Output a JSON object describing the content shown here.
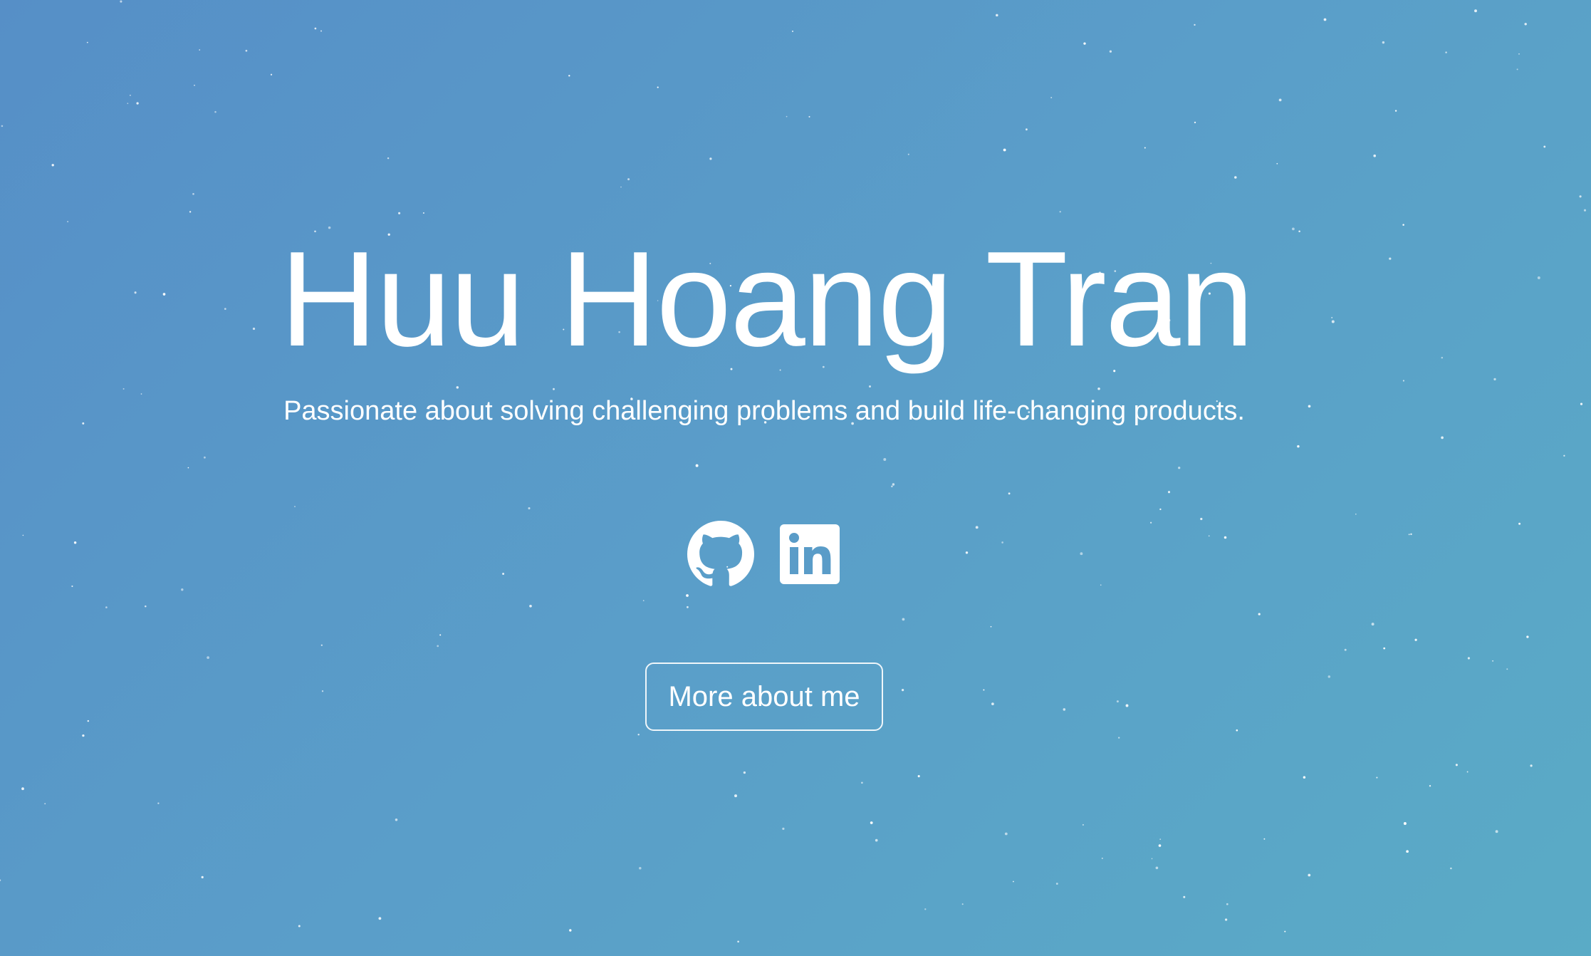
{
  "hero": {
    "title": "Huu Hoang Tran",
    "subtitle": "Passionate about solving challenging problems and build life-changing products."
  },
  "social": {
    "links": [
      {
        "icon": "github-icon"
      },
      {
        "icon": "linkedin-icon"
      }
    ]
  },
  "cta": {
    "label": "More about me"
  },
  "colors": {
    "background_start": "#568fc7",
    "background_end": "#5aabc6",
    "foreground": "#ffffff"
  }
}
